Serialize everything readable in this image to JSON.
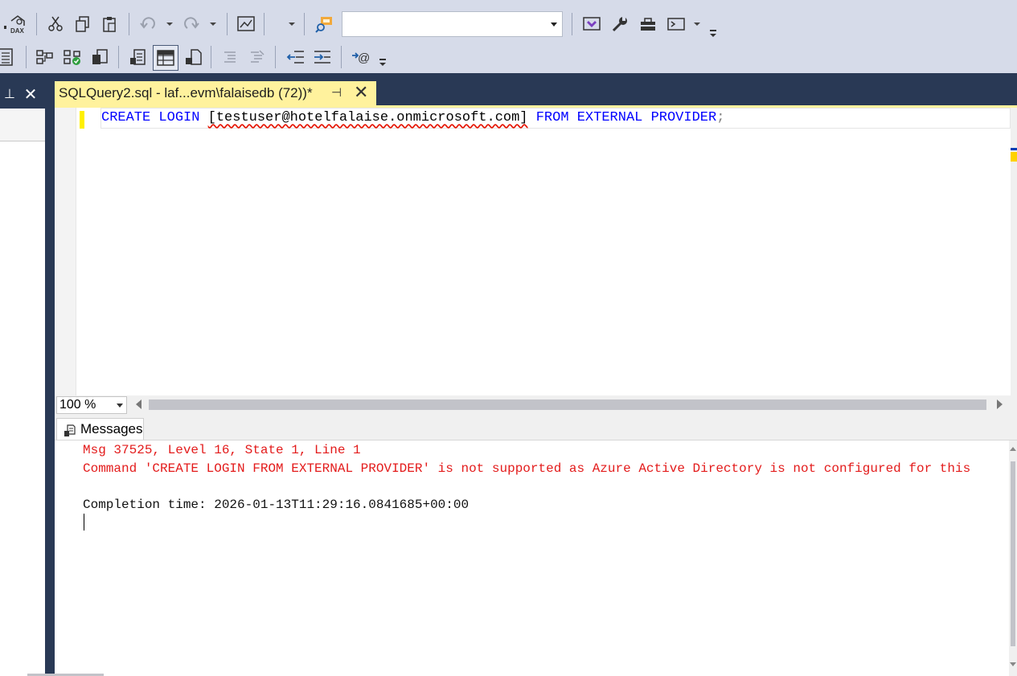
{
  "toolbar": {
    "database_combo_value": "",
    "icons_row1": [
      "dax-icon",
      "cut-icon",
      "copy-icon",
      "paste-icon",
      "undo-icon",
      "redo-icon",
      "design-query-icon",
      "find-icon",
      "visual-studio-icon",
      "wrench-icon",
      "toolbox-icon",
      "terminal-icon"
    ],
    "icons_row2": [
      "results-to-grid-icon",
      "display-plan-icon",
      "parse-icon",
      "query-options-icon",
      "results-to-text-icon",
      "results-grid-icon",
      "results-to-file-icon",
      "comment-icon",
      "uncomment-icon",
      "decrease-indent-icon",
      "increase-indent-icon",
      "specify-values-icon"
    ]
  },
  "document_tab": {
    "title": "SQLQuery2.sql - laf...evm\\falaisedb (72))*",
    "pin_glyph": "⊣",
    "close_glyph": "✕"
  },
  "left_panel": {
    "pin_glyph": "⊥",
    "close_glyph": "✕"
  },
  "editor": {
    "kw_create": "CREATE",
    "kw_login": "LOGIN",
    "login_name": "[testuser@hotelfalaise.onmicrosoft.com]",
    "kw_from": "FROM",
    "kw_external": "EXTERNAL",
    "kw_provider": "PROVIDER",
    "terminator": ";"
  },
  "status": {
    "zoom": "100 %"
  },
  "results": {
    "tab_label": "Messages",
    "error_line1": "Msg 37525, Level 16, State 1, Line 1",
    "error_line2": "Command 'CREATE LOGIN FROM EXTERNAL PROVIDER' is not supported as Azure Active Directory is not configured for this",
    "completion": "Completion time: 2026-01-13T11:29:16.0841685+00:00"
  },
  "colors": {
    "keyword": "#0000ff",
    "error": "#e31b1b",
    "tab_active": "#fff29d",
    "chrome": "#293955",
    "toolbar": "#d6dbe9"
  }
}
